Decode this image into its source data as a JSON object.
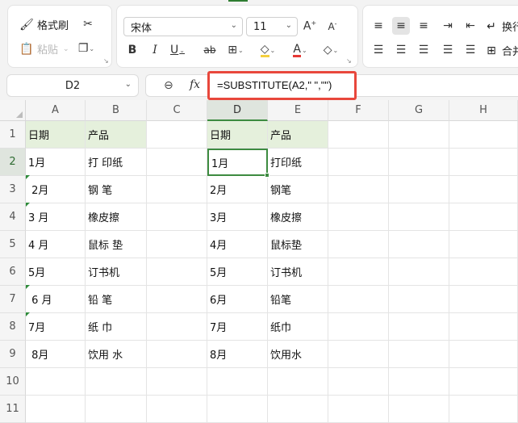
{
  "ribbon": {
    "format_painter": "格式刷",
    "paste": "粘贴",
    "font_name": "宋体",
    "font_size": "11",
    "wrap_text": "换行",
    "merge": "合并"
  },
  "formula_bar": {
    "name_box": "D2",
    "fx": "fx",
    "formula": "=SUBSTITUTE(A2,\" \",\"\")"
  },
  "columns": [
    "A",
    "B",
    "C",
    "D",
    "E",
    "F",
    "G",
    "H"
  ],
  "rows": [
    "1",
    "2",
    "3",
    "4",
    "5",
    "6",
    "7",
    "8",
    "9",
    "10",
    "11"
  ],
  "cells": {
    "A": [
      "日期",
      "1月",
      " 2月",
      "3 月",
      "4 月",
      "5月",
      " 6 月",
      "7月",
      " 8月"
    ],
    "B": [
      "产品",
      "打 印纸",
      "钢 笔",
      "橡皮擦",
      "鼠标 垫",
      "订书机",
      "铅 笔",
      "纸 巾",
      "饮用 水"
    ],
    "D": [
      "日期",
      "1月",
      "2月",
      "3月",
      "4月",
      "5月",
      "6月",
      "7月",
      "8月"
    ],
    "E": [
      "产品",
      "打印纸",
      "钢笔",
      "橡皮擦",
      "鼠标垫",
      "订书机",
      "铅笔",
      "纸巾",
      "饮用水"
    ]
  },
  "colors": {
    "accent": "#3d8b40",
    "header_fill": "#e5f0dc",
    "highlight_box": "#e8473c"
  }
}
